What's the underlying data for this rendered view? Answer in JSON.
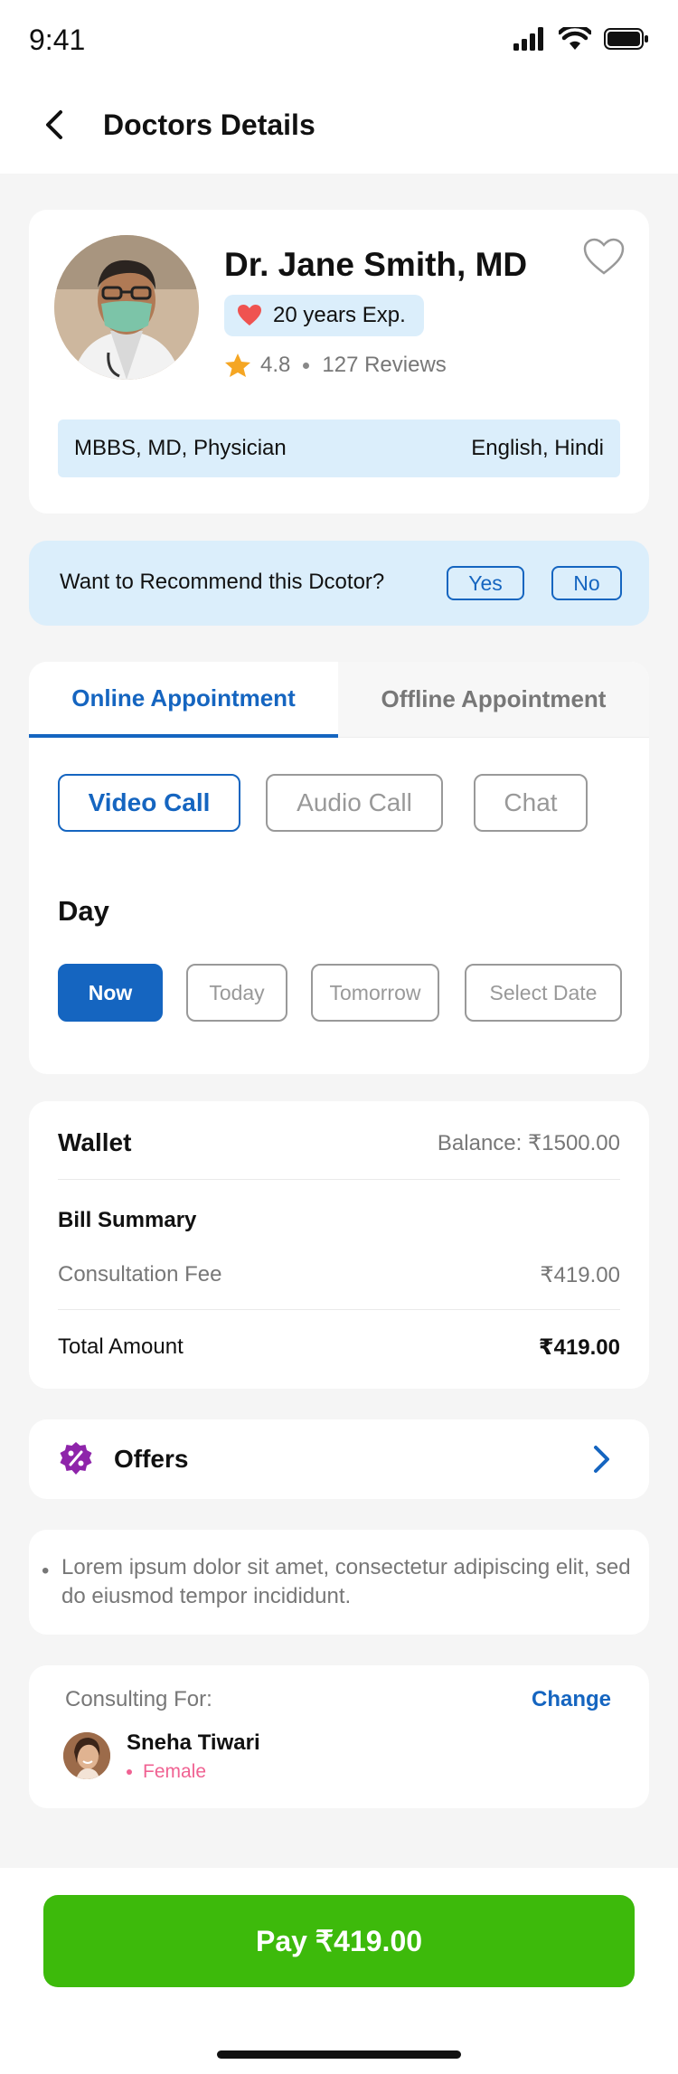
{
  "status_bar": {
    "time": "9:41"
  },
  "header": {
    "title": "Doctors Details"
  },
  "doctor": {
    "name": "Dr. Jane Smith, MD",
    "experience": "20 years Exp.",
    "rating": "4.8",
    "reviews": "127 Reviews",
    "qualifications": "MBBS, MD, Physician",
    "languages": "English, Hindi"
  },
  "recommend": {
    "question": "Want to Recommend  this Dcotor?",
    "yes_label": "Yes",
    "no_label": "No"
  },
  "appointment": {
    "tabs": [
      {
        "label": "Online Appointment",
        "active": true
      },
      {
        "label": "Offline Appointment",
        "active": false
      }
    ],
    "modes": [
      {
        "label": "Video Call",
        "selected": true
      },
      {
        "label": "Audio Call",
        "selected": false
      },
      {
        "label": "Chat",
        "selected": false
      }
    ],
    "day_label": "Day",
    "days": [
      {
        "label": "Now",
        "selected": true
      },
      {
        "label": "Today",
        "selected": false
      },
      {
        "label": "Tomorrow",
        "selected": false
      },
      {
        "label": "Select Date",
        "selected": false
      }
    ]
  },
  "wallet": {
    "title": "Wallet",
    "balance": "Balance:  ₹1500.00",
    "bill_title": "Bill Summary",
    "fee_label": "Consultation Fee",
    "fee_value": "₹419.00",
    "total_label": "Total Amount",
    "total_value": "₹419.00"
  },
  "offers": {
    "label": "Offers"
  },
  "note": {
    "text": "Lorem ipsum dolor sit amet, consectetur adipiscing elit, sed do eiusmod tempor incididunt."
  },
  "consulting": {
    "label": "Consulting For:",
    "change_label": "Change",
    "patient_name": "Sneha Tiwari",
    "patient_gender": "Female"
  },
  "pay": {
    "label": "Pay ₹419.00"
  },
  "colors": {
    "primary": "#1565c0",
    "pill_bg": "#dbeefb",
    "pay_green": "#3dba0b",
    "gender_pink": "#f06292",
    "offer_purple": "#8e24aa",
    "star": "#f5a623",
    "heart": "#ef5350"
  }
}
